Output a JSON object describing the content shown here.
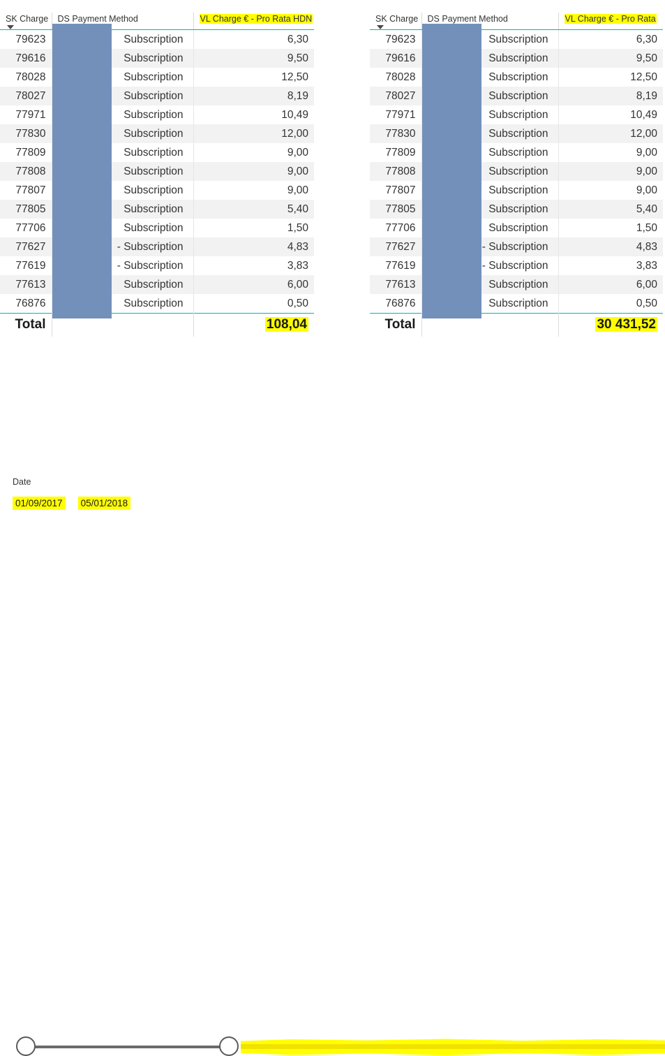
{
  "colors": {
    "highlight": "#ffff00",
    "redaction": "#7390bb",
    "accent_rule": "#01b8aa",
    "slider_track": "#6b6b6b"
  },
  "tables": [
    {
      "id": "left-table",
      "columns": {
        "id": "SK Charge",
        "payment_method": "DS Payment Method",
        "value": "VL Charge € - Pro Rata HDN"
      },
      "value_header_highlighted": true,
      "sort": {
        "column": "SK Charge",
        "direction": "descending"
      },
      "rows": [
        {
          "id": "79623",
          "payment_method": "Subscription",
          "value": "6,30"
        },
        {
          "id": "79616",
          "payment_method": "Subscription",
          "value": "9,50"
        },
        {
          "id": "78028",
          "payment_method": "Subscription",
          "value": "12,50"
        },
        {
          "id": "78027",
          "payment_method": "Subscription",
          "value": "8,19"
        },
        {
          "id": "77971",
          "payment_method": "Subscription",
          "value": "10,49"
        },
        {
          "id": "77830",
          "payment_method": "Subscription",
          "value": "12,00"
        },
        {
          "id": "77809",
          "payment_method": "Subscription",
          "value": "9,00"
        },
        {
          "id": "77808",
          "payment_method": "Subscription",
          "value": "9,00"
        },
        {
          "id": "77807",
          "payment_method": "Subscription",
          "value": "9,00"
        },
        {
          "id": "77805",
          "payment_method": "Subscription",
          "value": "5,40"
        },
        {
          "id": "77706",
          "payment_method": "Subscription",
          "value": "1,50"
        },
        {
          "id": "77627",
          "payment_method": "- Subscription",
          "value": "4,83"
        },
        {
          "id": "77619",
          "payment_method": "- Subscription",
          "value": "3,83"
        },
        {
          "id": "77613",
          "payment_method": "Subscription",
          "value": "6,00"
        },
        {
          "id": "76876",
          "payment_method": "Subscription",
          "value": "0,50"
        }
      ],
      "total": {
        "label": "Total",
        "value": "108,04",
        "highlighted": true
      }
    },
    {
      "id": "right-table",
      "columns": {
        "id": "SK Charge",
        "payment_method": "DS Payment Method",
        "value": "VL Charge € - Pro Rata"
      },
      "value_header_highlighted": true,
      "sort": {
        "column": "SK Charge",
        "direction": "descending"
      },
      "rows": [
        {
          "id": "79623",
          "payment_method": "Subscription",
          "value": "6,30"
        },
        {
          "id": "79616",
          "payment_method": "Subscription",
          "value": "9,50"
        },
        {
          "id": "78028",
          "payment_method": "Subscription",
          "value": "12,50"
        },
        {
          "id": "78027",
          "payment_method": "Subscription",
          "value": "8,19"
        },
        {
          "id": "77971",
          "payment_method": "Subscription",
          "value": "10,49"
        },
        {
          "id": "77830",
          "payment_method": "Subscription",
          "value": "12,00"
        },
        {
          "id": "77809",
          "payment_method": "Subscription",
          "value": "9,00"
        },
        {
          "id": "77808",
          "payment_method": "Subscription",
          "value": "9,00"
        },
        {
          "id": "77807",
          "payment_method": "Subscription",
          "value": "9,00"
        },
        {
          "id": "77805",
          "payment_method": "Subscription",
          "value": "5,40"
        },
        {
          "id": "77706",
          "payment_method": "Subscription",
          "value": "1,50"
        },
        {
          "id": "77627",
          "payment_method": "- Subscription",
          "value": "4,83"
        },
        {
          "id": "77619",
          "payment_method": "- Subscription",
          "value": "3,83"
        },
        {
          "id": "77613",
          "payment_method": "Subscription",
          "value": "6,00"
        },
        {
          "id": "76876",
          "payment_method": "Subscription",
          "value": "0,50"
        }
      ],
      "total": {
        "label": "Total",
        "value": "30 431,52",
        "highlighted": true
      }
    }
  ],
  "slicer": {
    "title": "Date",
    "start_date": "01/09/2017",
    "end_date": "05/01/2018",
    "start_highlighted": true,
    "end_highlighted": true
  }
}
